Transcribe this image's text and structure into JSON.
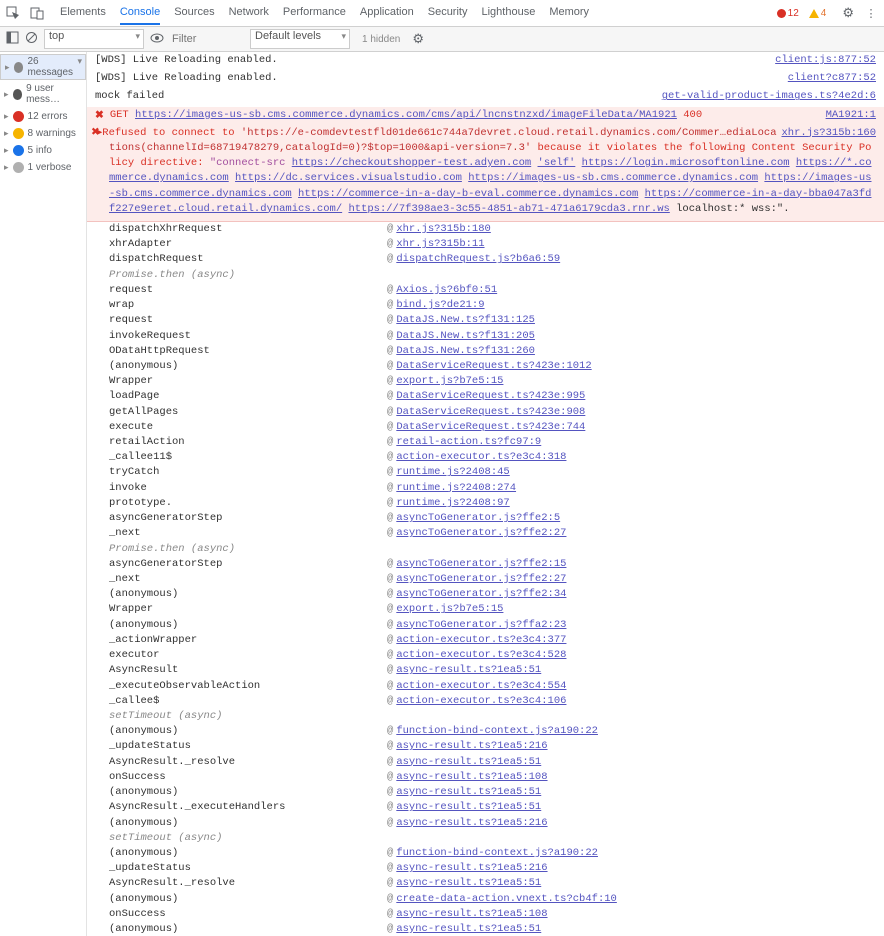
{
  "topbar": {
    "tabs": [
      "Elements",
      "Console",
      "Sources",
      "Network",
      "Performance",
      "Application",
      "Security",
      "Lighthouse",
      "Memory"
    ],
    "active_tab": "Console",
    "error_count": "12",
    "warn_count": "4"
  },
  "filterbar": {
    "context": "top",
    "filter_placeholder": "Filter",
    "levels": "Default levels",
    "hidden": "1 hidden"
  },
  "sidebar": {
    "items": [
      {
        "label": "26 messages",
        "badge": "b-msg"
      },
      {
        "label": "9 user mess…",
        "badge": "b-user"
      },
      {
        "label": "12 errors",
        "badge": "b-err"
      },
      {
        "label": "8 warnings",
        "badge": "b-warn"
      },
      {
        "label": "5 info",
        "badge": "b-info"
      },
      {
        "label": "1 verbose",
        "badge": "b-verb"
      }
    ]
  },
  "log_pre": [
    {
      "msg": "[WDS] Live Reloading enabled.",
      "src": "client:js:877:52"
    },
    {
      "msg": "[WDS] Live Reloading enabled.",
      "src": "client?c877:52"
    },
    {
      "msg": "mock failed",
      "src": "get-valid-product-images.ts?4e2d:6"
    }
  ],
  "get_error": {
    "method": "GET",
    "url": "https://images-us-sb.cms.commerce.dynamics.com/cms/api/lncnstnzxd/imageFileData/MA1921",
    "status": "400",
    "src": "MA1921:1"
  },
  "csp": {
    "prefix": "▸Refused to connect to ",
    "target": "'https://e-comdevtestfld01de661c744a7devret.cloud.retail.dynamics.com/Commer…ediaLocations(channelId=68719478279,catalogId=0)?$top=1000&api-version=7.3'",
    "because": " because it violates the following Content Security Policy directive: ",
    "directive": "\"connect-src ",
    "urls": [
      "https://checkoutshopper-test.adyen.com",
      "'self'",
      "https://login.microsoftonline.com",
      "https://*.commerce.dynamics.com",
      "https://dc.services.visualstudio.com",
      "https://images-us-sb.cms.commerce.dynamics.com",
      "https://images-us-sb.cms.commerce.dynamics.com",
      "https://commerce-in-a-day-b-eval.commerce.dynamics.com",
      "https://commerce-in-a-day-bba047a3fdf227e9eret.cloud.retail.dynamics.com/",
      "https://7f398ae3-3c55-4851-ab71-471a6179cda3.rnr.ws"
    ],
    "tail": " localhost:* wss:\".",
    "right_src": "xhr.js?315b:160"
  },
  "trace": [
    {
      "fn": "dispatchXhrRequest",
      "loc": "xhr.js?315b:180"
    },
    {
      "fn": "xhrAdapter",
      "loc": "xhr.js?315b:11"
    },
    {
      "fn": "dispatchRequest",
      "loc": "dispatchRequest.js?b6a6:59"
    },
    {
      "fn": "Promise.then (async)",
      "async": true
    },
    {
      "fn": "request",
      "loc": "Axios.js?6bf0:51"
    },
    {
      "fn": "wrap",
      "loc": "bind.js?de21:9"
    },
    {
      "fn": "request",
      "loc": "DataJS.New.ts?f131:125"
    },
    {
      "fn": "invokeRequest",
      "loc": "DataJS.New.ts?f131:205"
    },
    {
      "fn": "ODataHttpRequest",
      "loc": "DataJS.New.ts?f131:260"
    },
    {
      "fn": "(anonymous)",
      "loc": "DataServiceRequest.ts?423e:1012"
    },
    {
      "fn": "Wrapper",
      "loc": "export.js?b7e5:15"
    },
    {
      "fn": "loadPage",
      "loc": "DataServiceRequest.ts?423e:995"
    },
    {
      "fn": "getAllPages",
      "loc": "DataServiceRequest.ts?423e:908"
    },
    {
      "fn": "execute",
      "loc": "DataServiceRequest.ts?423e:744"
    },
    {
      "fn": "retailAction",
      "loc": "retail-action.ts?fc97:9"
    },
    {
      "fn": "_callee11$",
      "loc": "action-executor.ts?e3c4:318"
    },
    {
      "fn": "tryCatch",
      "loc": "runtime.js?2408:45"
    },
    {
      "fn": "invoke",
      "loc": "runtime.js?2408:274"
    },
    {
      "fn": "prototype.<computed>",
      "loc": "runtime.js?2408:97"
    },
    {
      "fn": "asyncGeneratorStep",
      "loc": "asyncToGenerator.js?ffe2:5"
    },
    {
      "fn": "_next",
      "loc": "asyncToGenerator.js?ffe2:27"
    },
    {
      "fn": "Promise.then (async)",
      "async": true
    },
    {
      "fn": "asyncGeneratorStep",
      "loc": "asyncToGenerator.js?ffe2:15"
    },
    {
      "fn": "_next",
      "loc": "asyncToGenerator.js?ffe2:27"
    },
    {
      "fn": "(anonymous)",
      "loc": "asyncToGenerator.js?ffe2:34"
    },
    {
      "fn": "Wrapper",
      "loc": "export.js?b7e5:15"
    },
    {
      "fn": "(anonymous)",
      "loc": "asyncToGenerator.js?ffa2:23"
    },
    {
      "fn": "_actionWrapper",
      "loc": "action-executor.ts?e3c4:377"
    },
    {
      "fn": "executor",
      "loc": "action-executor.ts?e3c4:528"
    },
    {
      "fn": "AsyncResult",
      "loc": "async-result.ts?1ea5:51"
    },
    {
      "fn": "_executeObservableAction",
      "loc": "action-executor.ts?e3c4:554"
    },
    {
      "fn": "_callee$",
      "loc": "action-executor.ts?e3c4:106"
    },
    {
      "fn": "setTimeout (async)",
      "async": true
    },
    {
      "fn": "(anonymous)",
      "loc": "function-bind-context.js?a190:22"
    },
    {
      "fn": "_updateStatus",
      "loc": "async-result.ts?1ea5:216"
    },
    {
      "fn": "AsyncResult._resolve",
      "loc": "async-result.ts?1ea5:51"
    },
    {
      "fn": "onSuccess",
      "loc": "async-result.ts?1ea5:108"
    },
    {
      "fn": "(anonymous)",
      "loc": "async-result.ts?1ea5:51"
    },
    {
      "fn": "AsyncResult._executeHandlers",
      "loc": "async-result.ts?1ea5:51"
    },
    {
      "fn": "(anonymous)",
      "loc": "async-result.ts?1ea5:216"
    },
    {
      "fn": "setTimeout (async)",
      "async": true
    },
    {
      "fn": "(anonymous)",
      "loc": "function-bind-context.js?a190:22"
    },
    {
      "fn": "_updateStatus",
      "loc": "async-result.ts?1ea5:216"
    },
    {
      "fn": "AsyncResult._resolve",
      "loc": "async-result.ts?1ea5:51"
    },
    {
      "fn": "(anonymous)",
      "loc": "create-data-action.vnext.ts?cb4f:10"
    },
    {
      "fn": "onSuccess",
      "loc": "async-result.ts?1ea5:108"
    },
    {
      "fn": "(anonymous)",
      "loc": "async-result.ts?1ea5:51"
    }
  ]
}
